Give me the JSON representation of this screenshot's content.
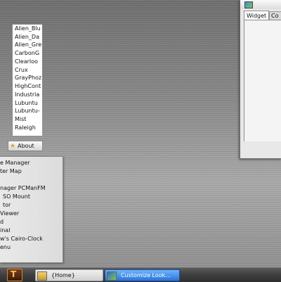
{
  "start_menu": {
    "items": [
      "e Manager",
      "ter Map",
      "",
      "nager PCManFM",
      "SO Mount",
      "tor",
      "Viewer",
      "d",
      "inal",
      "w's Cairo-Clock",
      "enu"
    ]
  },
  "taskbar": {
    "start_glyph": "T",
    "tasks": [
      {
        "label": "{Home}"
      },
      {
        "label": "Customize Look..."
      }
    ]
  },
  "window": {
    "tabs": [
      "Widget",
      "Co"
    ],
    "themes": [
      "Alien_Blu",
      "Alien_Da",
      "Alien_Gre",
      "CarbonG",
      "Clearloo",
      "Crux",
      "GrayPhoz",
      "HighCont",
      "Industria",
      "Lubuntu",
      "Lubuntu-",
      "Mist",
      "Raleigh"
    ],
    "about_label": "About"
  }
}
